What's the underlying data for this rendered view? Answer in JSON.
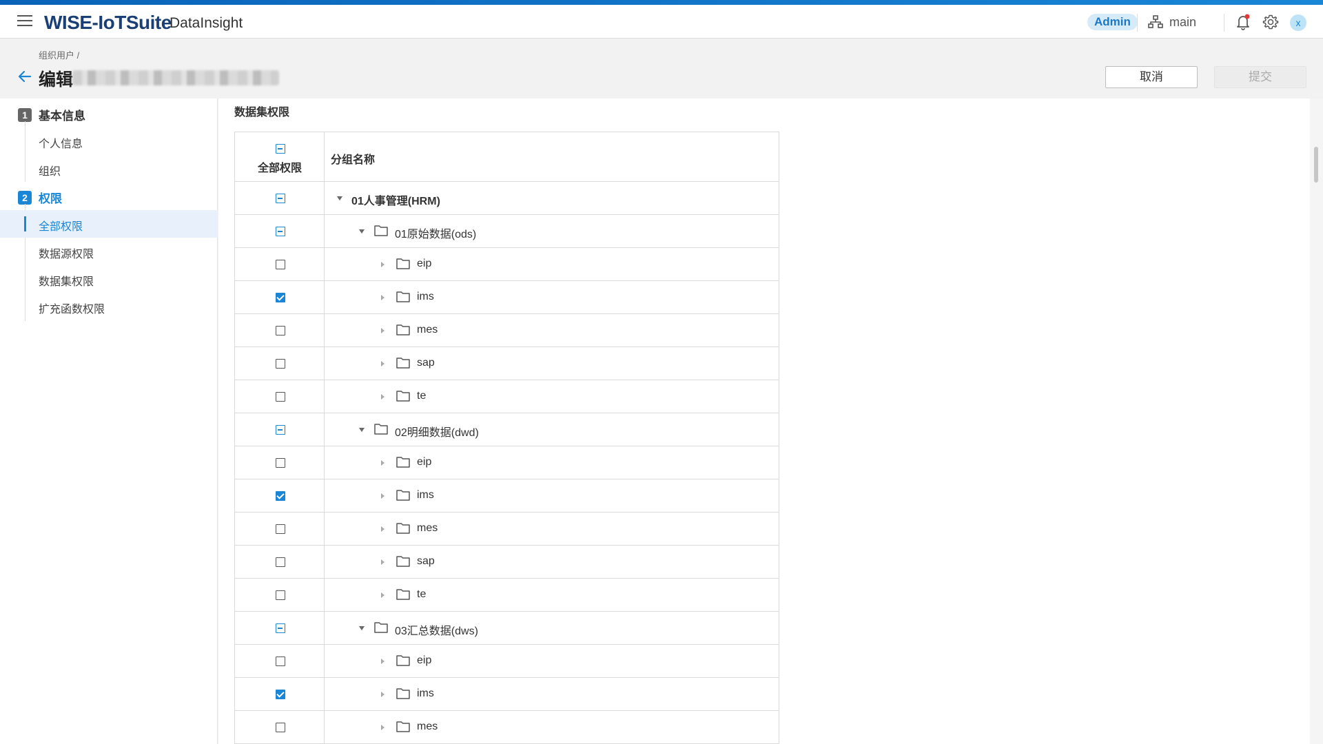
{
  "header": {
    "logo": "WISE-IoTSuite",
    "product": "DataInsight",
    "role_badge": "Admin",
    "org_name": "main",
    "avatar_initial": "x"
  },
  "page": {
    "breadcrumb": "组织用户  /",
    "title": "编辑",
    "cancel_label": "取消",
    "submit_label": "提交"
  },
  "sidebar": {
    "steps": [
      {
        "num": "1",
        "label": "基本信息",
        "active": false
      },
      {
        "num": "2",
        "label": "权限",
        "active": true
      }
    ],
    "sub_items": [
      "个人信息",
      "组织",
      "全部权限",
      "数据源权限",
      "数据集权限",
      "扩充函数权限"
    ],
    "active_sub": "全部权限"
  },
  "content": {
    "section_title": "数据集权限",
    "table": {
      "col_all": "全部权限",
      "col_name": "分组名称",
      "header_state": "partial",
      "rows": [
        {
          "label": "01人事管理(HRM)",
          "level": 0,
          "state": "partial",
          "expanded": true,
          "folder": false,
          "bold": true
        },
        {
          "label": "01原始数据(ods)",
          "level": 1,
          "state": "partial",
          "expanded": true,
          "folder": true
        },
        {
          "label": "eip",
          "level": 2,
          "state": "unchecked",
          "expanded": false,
          "folder": true
        },
        {
          "label": "ims",
          "level": 2,
          "state": "checked",
          "expanded": false,
          "folder": true
        },
        {
          "label": "mes",
          "level": 2,
          "state": "unchecked",
          "expanded": false,
          "folder": true
        },
        {
          "label": "sap",
          "level": 2,
          "state": "unchecked",
          "expanded": false,
          "folder": true
        },
        {
          "label": "te",
          "level": 2,
          "state": "unchecked",
          "expanded": false,
          "folder": true
        },
        {
          "label": "02明细数据(dwd)",
          "level": 1,
          "state": "partial",
          "expanded": true,
          "folder": true
        },
        {
          "label": "eip",
          "level": 2,
          "state": "unchecked",
          "expanded": false,
          "folder": true
        },
        {
          "label": "ims",
          "level": 2,
          "state": "checked",
          "expanded": false,
          "folder": true
        },
        {
          "label": "mes",
          "level": 2,
          "state": "unchecked",
          "expanded": false,
          "folder": true
        },
        {
          "label": "sap",
          "level": 2,
          "state": "unchecked",
          "expanded": false,
          "folder": true
        },
        {
          "label": "te",
          "level": 2,
          "state": "unchecked",
          "expanded": false,
          "folder": true
        },
        {
          "label": "03汇总数据(dws)",
          "level": 1,
          "state": "partial",
          "expanded": true,
          "folder": true
        },
        {
          "label": "eip",
          "level": 2,
          "state": "unchecked",
          "expanded": false,
          "folder": true
        },
        {
          "label": "ims",
          "level": 2,
          "state": "checked",
          "expanded": false,
          "folder": true
        },
        {
          "label": "mes",
          "level": 2,
          "state": "unchecked",
          "expanded": false,
          "folder": true
        }
      ]
    }
  },
  "colors": {
    "accent": "#1a86d6",
    "logo": "#1a3f77",
    "active_bg": "#e8f1fb"
  }
}
